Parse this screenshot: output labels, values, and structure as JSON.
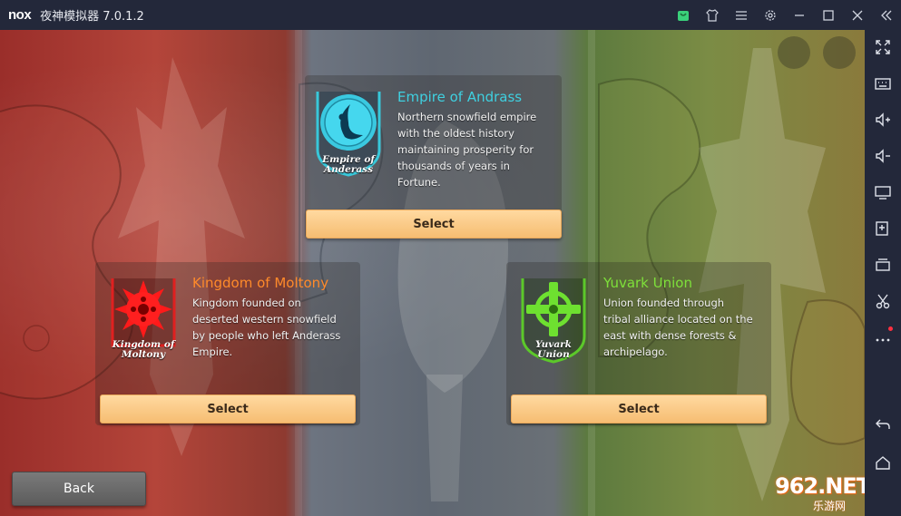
{
  "window": {
    "logo": "nox",
    "title": "夜神模拟器 7.0.1.2"
  },
  "titlebar_icons": [
    "app-store-icon",
    "skin-icon",
    "menu-icon",
    "settings-icon",
    "minimize-icon",
    "maximize-icon",
    "close-icon",
    "collapse-sidebar-icon"
  ],
  "sidebar_icons": [
    "fullscreen-icon",
    "keyboard-icon",
    "volume-up-icon",
    "volume-down-icon",
    "screen-icon",
    "install-apk-icon",
    "multi-instance-icon",
    "screenshot-icon",
    "more-icon",
    "back-icon",
    "home-icon"
  ],
  "factions": [
    {
      "name": "Empire of Andrass",
      "description": "Northern snowfield empire with the oldest history maintaining prosperity for thousands of years in Fortune.",
      "description_lines": [
        "Northern snowfield empire",
        "with the oldest history",
        "maintaining prosperity for",
        "thousands of years in",
        "Fortune."
      ],
      "emblem_label_lines": [
        "Empire of",
        "Anderass"
      ],
      "emblem_icon": "crescent-moon-icon",
      "color": "#3fd0e0",
      "select_label": "Select"
    },
    {
      "name": "Kingdom of Moltony",
      "description": "Kingdom founded on deserted western snowfield by people who left Anderass Empire.",
      "description_lines": [
        "Kingdom founded on",
        "deserted western snowfield",
        "by people who left Anderass",
        "Empire."
      ],
      "emblem_label_lines": [
        "Kingdom of",
        "Moltony"
      ],
      "emblem_icon": "spiked-sun-icon",
      "color": "#ff8a2a",
      "select_label": "Select"
    },
    {
      "name": "Yuvark Union",
      "description": "Union founded through tribal alliance located on the east with dense forests & archipelago.",
      "description_lines": [
        "Union founded through",
        "tribal alliance located on the",
        "east with dense forests &",
        "archipelago."
      ],
      "emblem_label_lines": [
        "Yuvark",
        "Union"
      ],
      "emblem_icon": "celtic-cross-icon",
      "color": "#7ee03a",
      "select_label": "Select"
    }
  ],
  "back_label": "Back",
  "watermark": {
    "main": "962.NET",
    "sub": "乐游网"
  }
}
